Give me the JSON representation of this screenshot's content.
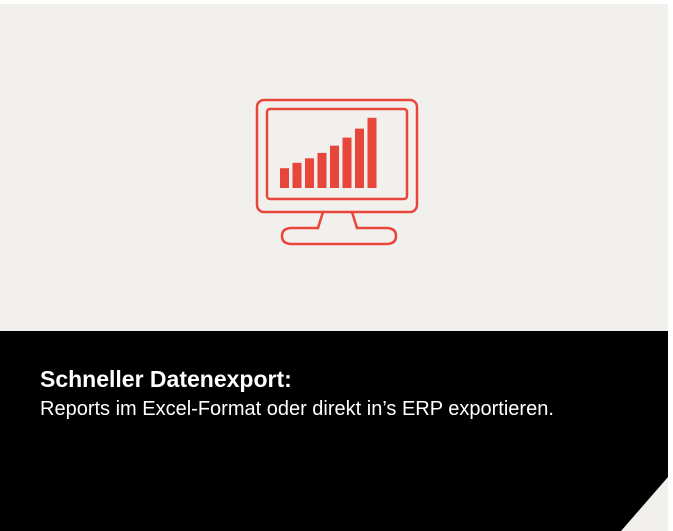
{
  "colors": {
    "panel_background": "#f1f0ed",
    "caption_background": "#000000",
    "caption_text": "#ffffff",
    "accent": "#e8463a"
  },
  "feature": {
    "icon": "monitor-bar-chart-icon",
    "bar_levels": [
      0.22,
      0.28,
      0.33,
      0.39,
      0.47,
      0.56,
      0.66,
      0.78
    ],
    "title": "Schneller Datenexport:",
    "description": "Reports im Excel-Format oder direkt in’s ERP exportieren."
  }
}
